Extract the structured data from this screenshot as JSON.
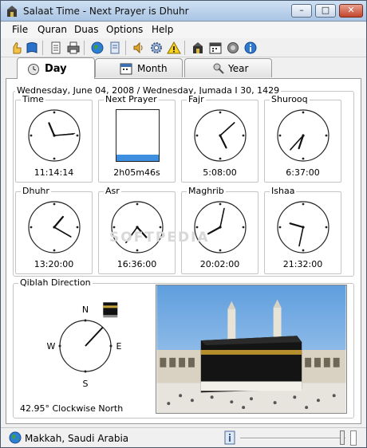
{
  "window": {
    "title": "Salaat Time - Next Prayer is Dhuhr",
    "buttons": {
      "minimize": "–",
      "maximize": "□",
      "close": "✕"
    }
  },
  "menu": {
    "items": [
      "File",
      "Quran",
      "Duas",
      "Options",
      "Help"
    ]
  },
  "toolbar": {
    "icons": [
      "thumb-icon",
      "book-icon",
      "notes-icon",
      "print-icon",
      "globe-icon",
      "document-icon",
      "speaker-icon",
      "settings-icon",
      "warning-icon",
      "mosque-icon",
      "calendar-icon",
      "sound-icon",
      "info-icon"
    ]
  },
  "tabs": [
    {
      "label": "Day",
      "icon": "clock-icon",
      "active": true
    },
    {
      "label": "Month",
      "icon": "calendar-icon",
      "active": false
    },
    {
      "label": "Year",
      "icon": "tools-icon",
      "active": false
    }
  ],
  "date_header": "Wednesday, June 04, 2008 / Wednesday, Jumada I 30, 1429",
  "clocks": [
    {
      "title": "Time",
      "time": "11:14:14"
    },
    {
      "title": "Next Prayer",
      "time": "2h05m46s",
      "progress": 0.12
    },
    {
      "title": "Fajr",
      "time": "5:08:00"
    },
    {
      "title": "Shurooq",
      "time": "6:37:00"
    },
    {
      "title": "Dhuhr",
      "time": "13:20:00"
    },
    {
      "title": "Asr",
      "time": "16:36:00"
    },
    {
      "title": "Maghrib",
      "time": "20:02:00"
    },
    {
      "title": "Ishaa",
      "time": "21:32:00"
    }
  ],
  "qiblah": {
    "title": "Qiblah Direction",
    "direction_text": "42.95° Clockwise North",
    "angle_deg": 42.95,
    "compass": {
      "n": "N",
      "e": "E",
      "s": "S",
      "w": "W"
    }
  },
  "watermark": "SOFTPEDIA",
  "status": {
    "location": "Makkah, Saudi Arabia"
  },
  "colors": {
    "accent": "#3f8fe0",
    "titlebar": "#a9c4e3"
  }
}
